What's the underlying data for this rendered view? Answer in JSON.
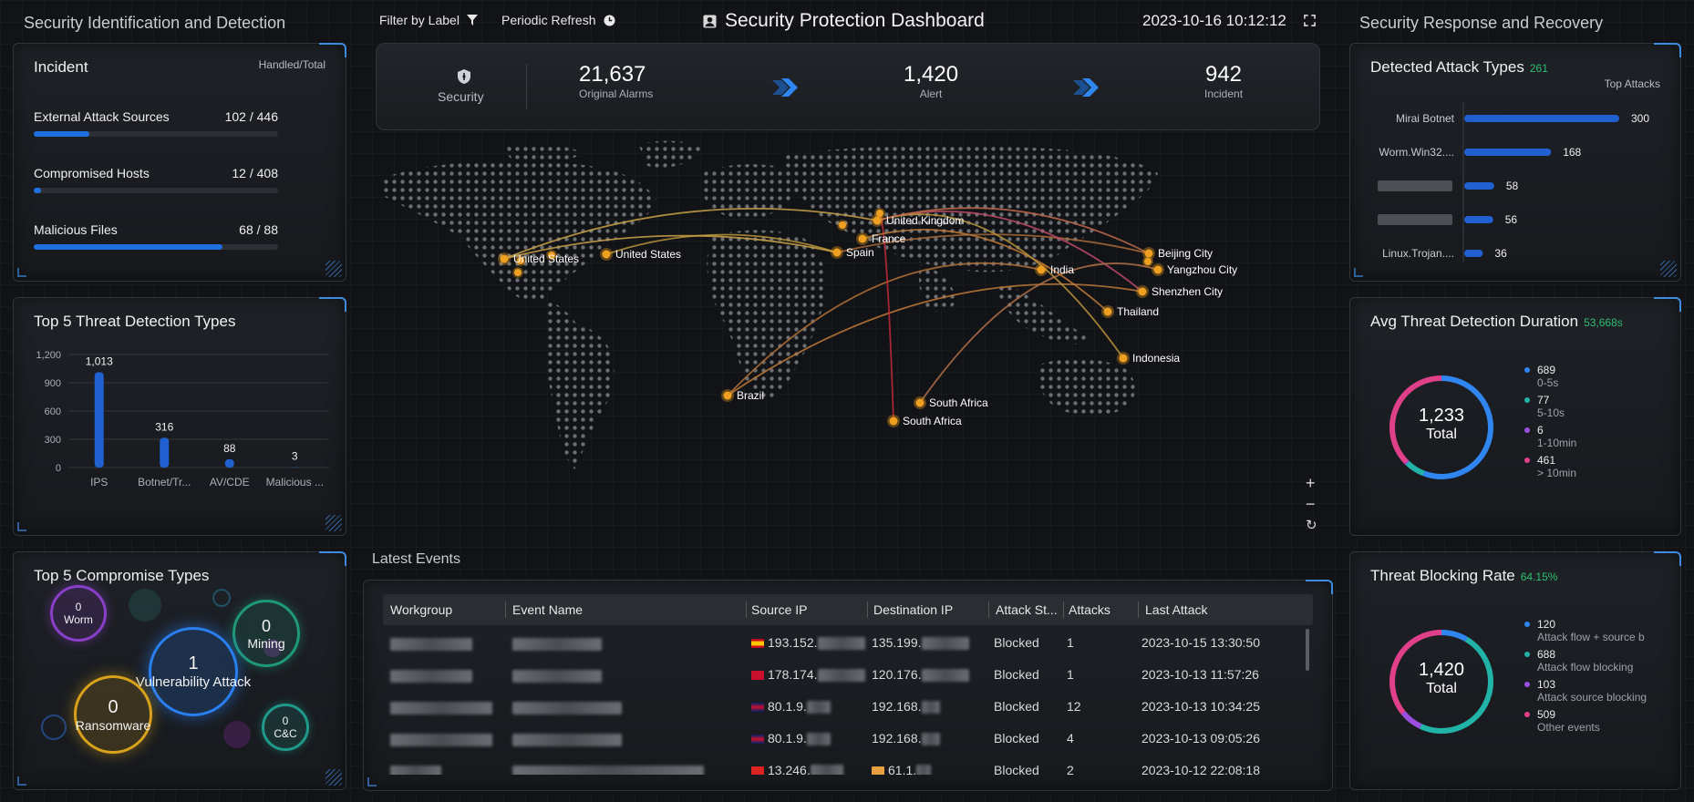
{
  "header": {
    "left_title": "Security Identification and Detection",
    "right_title": "Security Response and Recovery",
    "filter_label": "Filter by Label",
    "refresh_label": "Periodic Refresh",
    "dashboard_title": "Security Protection Dashboard",
    "datetime": "2023-10-16 10:12:12"
  },
  "incident": {
    "title": "Incident",
    "header_right": "Handled/Total",
    "rows": [
      {
        "label": "External Attack Sources",
        "value": "102 / 446",
        "ratio": 0.229
      },
      {
        "label": "Compromised Hosts",
        "value": "12 / 408",
        "ratio": 0.029
      },
      {
        "label": "Malicious Files",
        "value": "68 / 88",
        "ratio": 0.773
      }
    ]
  },
  "threat_types": {
    "title": "Top 5 Threat Detection Types",
    "chart_data": {
      "type": "bar",
      "categories": [
        "IPS",
        "Botnet/Tr...",
        "AV/CDE",
        "Malicious ..."
      ],
      "values": [
        1013,
        316,
        88,
        3
      ],
      "value_labels": [
        "1,013",
        "316",
        "88",
        "3"
      ],
      "yticks": [
        "0",
        "300",
        "600",
        "900",
        "1,200"
      ],
      "ylim": [
        0,
        1200
      ]
    }
  },
  "compromise": {
    "title": "Top 5 Compromise Types",
    "bubbles": [
      {
        "name": "Worm",
        "value": "0"
      },
      {
        "name": "Mining",
        "value": "0"
      },
      {
        "name": "Vulnerability Attack",
        "value": "1"
      },
      {
        "name": "Ransomware",
        "value": "0"
      },
      {
        "name": "C&C",
        "value": "0"
      }
    ]
  },
  "stats": {
    "security_label": "Security",
    "items": [
      {
        "value": "21,637",
        "label": "Original Alarms"
      },
      {
        "value": "1,420",
        "label": "Alert"
      },
      {
        "value": "942",
        "label": "Incident"
      }
    ]
  },
  "map": {
    "locations": [
      "United Kingdom",
      "France",
      "Spain",
      "United States",
      "United States",
      "India",
      "Beijing City",
      "Yangzhou City",
      "Shenzhen City",
      "Thailand",
      "Indonesia",
      "Brazil",
      "South Africa",
      "South Africa"
    ],
    "zoom_in": "+",
    "zoom_out": "−",
    "reset": "↻"
  },
  "events": {
    "title": "Latest Events",
    "columns": [
      "Workgroup",
      "Event Name",
      "Source IP",
      "Destination IP",
      "Attack St...",
      "Attacks",
      "Last Attack"
    ],
    "rows": [
      {
        "src": "193.152.",
        "dst": "135.199.",
        "status": "Blocked",
        "attacks": "1",
        "last": "2023-10-15 13:30:50"
      },
      {
        "src": "178.174.",
        "dst": "120.176.",
        "status": "Blocked",
        "attacks": "1",
        "last": "2023-10-13 11:57:26"
      },
      {
        "src": "80.1.9.",
        "dst": "192.168.",
        "status": "Blocked",
        "attacks": "12",
        "last": "2023-10-13 10:34:25"
      },
      {
        "src": "80.1.9.",
        "dst": "192.168.",
        "status": "Blocked",
        "attacks": "4",
        "last": "2023-10-13 09:05:26"
      },
      {
        "src": "13.246.",
        "dst": "61.1.",
        "status": "Blocked",
        "attacks": "2",
        "last": "2023-10-12 22:08:18"
      }
    ]
  },
  "attack_types": {
    "title": "Detected Attack Types",
    "count": "261",
    "subtitle": "Top Attacks",
    "chart_data": {
      "type": "bar",
      "categories": [
        "Mirai Botnet",
        "Worm.Win32....",
        "",
        "",
        "Linux.Trojan...."
      ],
      "values": [
        300,
        168,
        58,
        56,
        36
      ]
    }
  },
  "duration": {
    "title": "Avg Threat Detection Duration",
    "sub": "53,668s",
    "total_value": "1,233",
    "total_label": "Total",
    "legend": [
      {
        "value": "689",
        "desc": "0-5s",
        "color": "#2f86f0"
      },
      {
        "value": "77",
        "desc": "5-10s",
        "color": "#22b3a8"
      },
      {
        "value": "6",
        "desc": "1-10min",
        "color": "#9b4fe0"
      },
      {
        "value": "461",
        "desc": "> 10min",
        "color": "#e0408a"
      }
    ]
  },
  "blocking": {
    "title": "Threat Blocking Rate",
    "sub": "64.15%",
    "total_value": "1,420",
    "total_label": "Total",
    "legend": [
      {
        "value": "120",
        "desc": "Attack flow + source b",
        "color": "#2f86f0"
      },
      {
        "value": "688",
        "desc": "Attack flow blocking",
        "color": "#22b3a8"
      },
      {
        "value": "103",
        "desc": "Attack source blocking",
        "color": "#9b4fe0"
      },
      {
        "value": "509",
        "desc": "Other events",
        "color": "#e0408a"
      }
    ]
  }
}
